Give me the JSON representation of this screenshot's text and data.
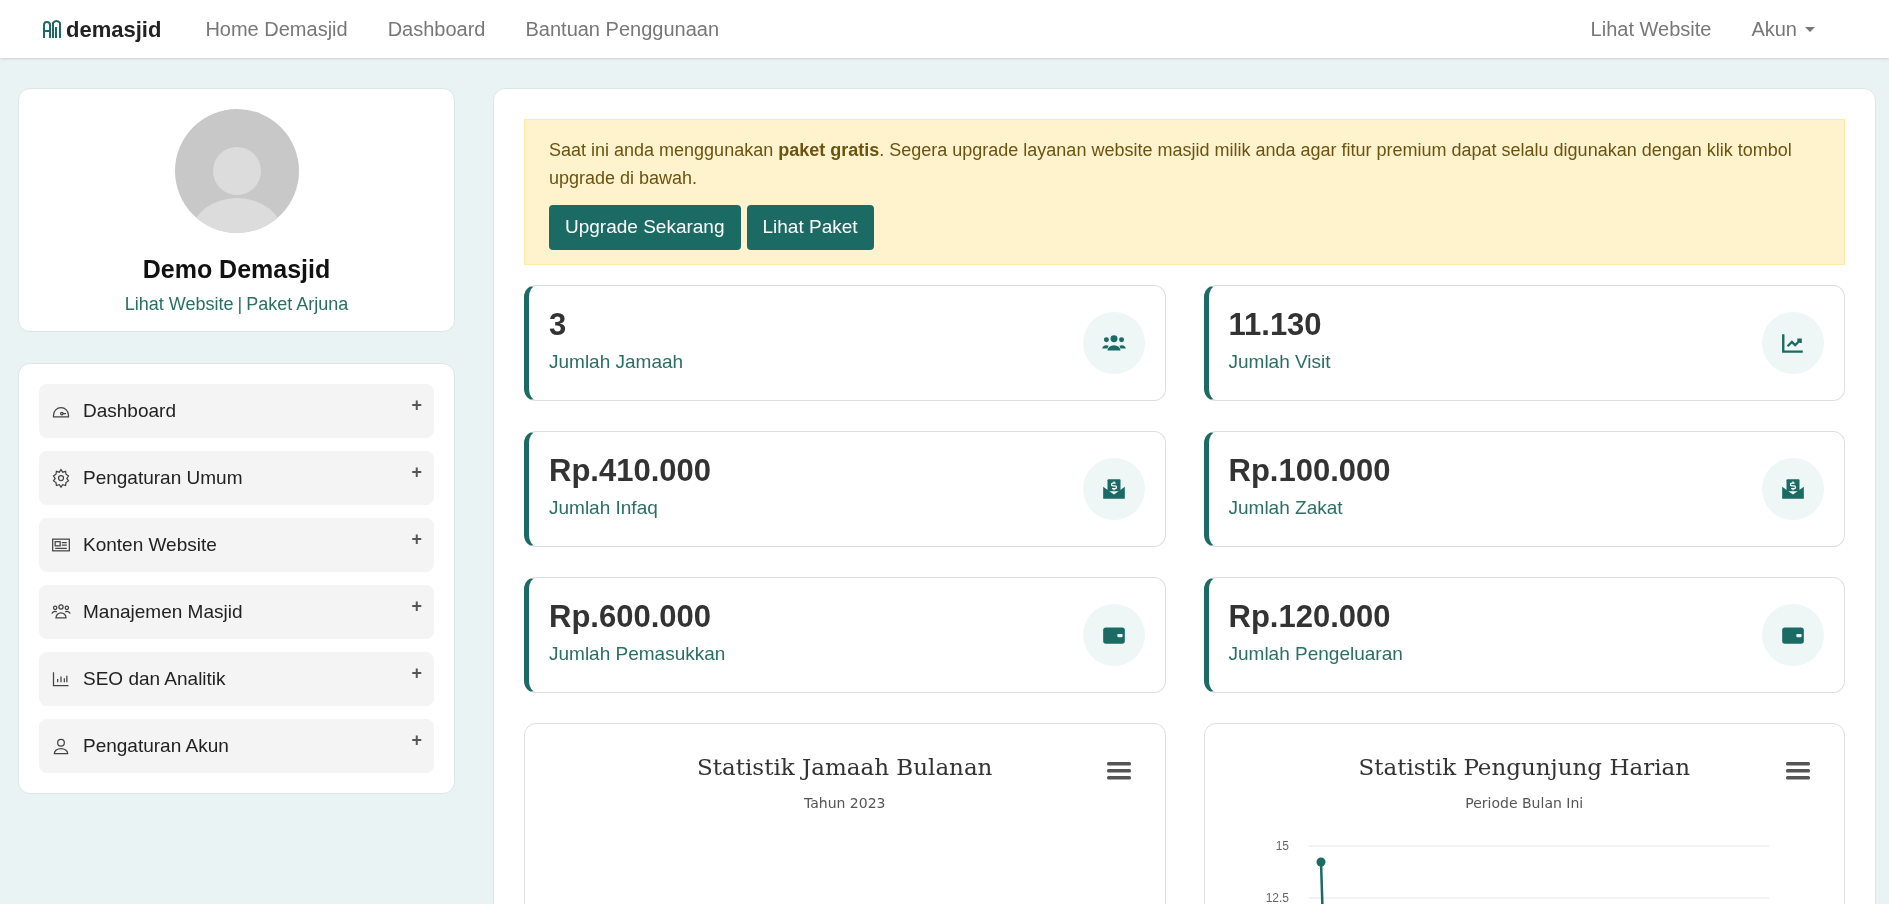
{
  "navbar": {
    "brand": "demasjid",
    "links": [
      "Home Demasjid",
      "Dashboard",
      "Bantuan Penggunaan"
    ],
    "right_links": [
      "Lihat Website",
      "Akun"
    ]
  },
  "profile": {
    "name": "Demo Demasjid",
    "website_link": "Lihat Website",
    "separator": "|",
    "package": "Paket Arjuna"
  },
  "menu": [
    {
      "kind": "gauge",
      "label": "Dashboard",
      "toggle": "+"
    },
    {
      "kind": "gear",
      "label": "Pengaturan Umum",
      "toggle": "+"
    },
    {
      "kind": "newspaper",
      "label": "Konten Website",
      "toggle": "+"
    },
    {
      "kind": "people",
      "label": "Manajemen Masjid",
      "toggle": "+"
    },
    {
      "kind": "bars",
      "label": "SEO dan Analitik",
      "toggle": "+"
    },
    {
      "kind": "person",
      "label": "Pengaturan Akun",
      "toggle": "+"
    }
  ],
  "alert": {
    "text": "Saat ini anda menggunakan **paket gratis**. Segera upgrade layanan website masjid milik anda agar fitur premium dapat selalu digunakan dengan klik tombol upgrade di bawah.",
    "buttons": [
      "Upgrade Sekarang",
      "Lihat Paket"
    ]
  },
  "stats": [
    {
      "value": "3",
      "label": "Jumlah Jamaah",
      "kind": "users"
    },
    {
      "value": "11.130",
      "label": "Jumlah Visit",
      "kind": "chart"
    },
    {
      "value": "Rp.410.000",
      "label": "Jumlah Infaq",
      "kind": "envelope"
    },
    {
      "value": "Rp.100.000",
      "label": "Jumlah Zakat",
      "kind": "envelope"
    },
    {
      "value": "Rp.600.000",
      "label": "Jumlah Pemasukkan",
      "kind": "wallet"
    },
    {
      "value": "Rp.120.000",
      "label": "Jumlah Pengeluaran",
      "kind": "wallet"
    }
  ],
  "charts": [
    {
      "title": "Statistik Jamaah Bulanan",
      "subtitle": "Tahun 2023"
    },
    {
      "title": "Statistik Pengunjung Harian",
      "subtitle": "Periode Bulan Ini",
      "y_axis_labels": [
        "15",
        "12.5"
      ]
    }
  ]
}
